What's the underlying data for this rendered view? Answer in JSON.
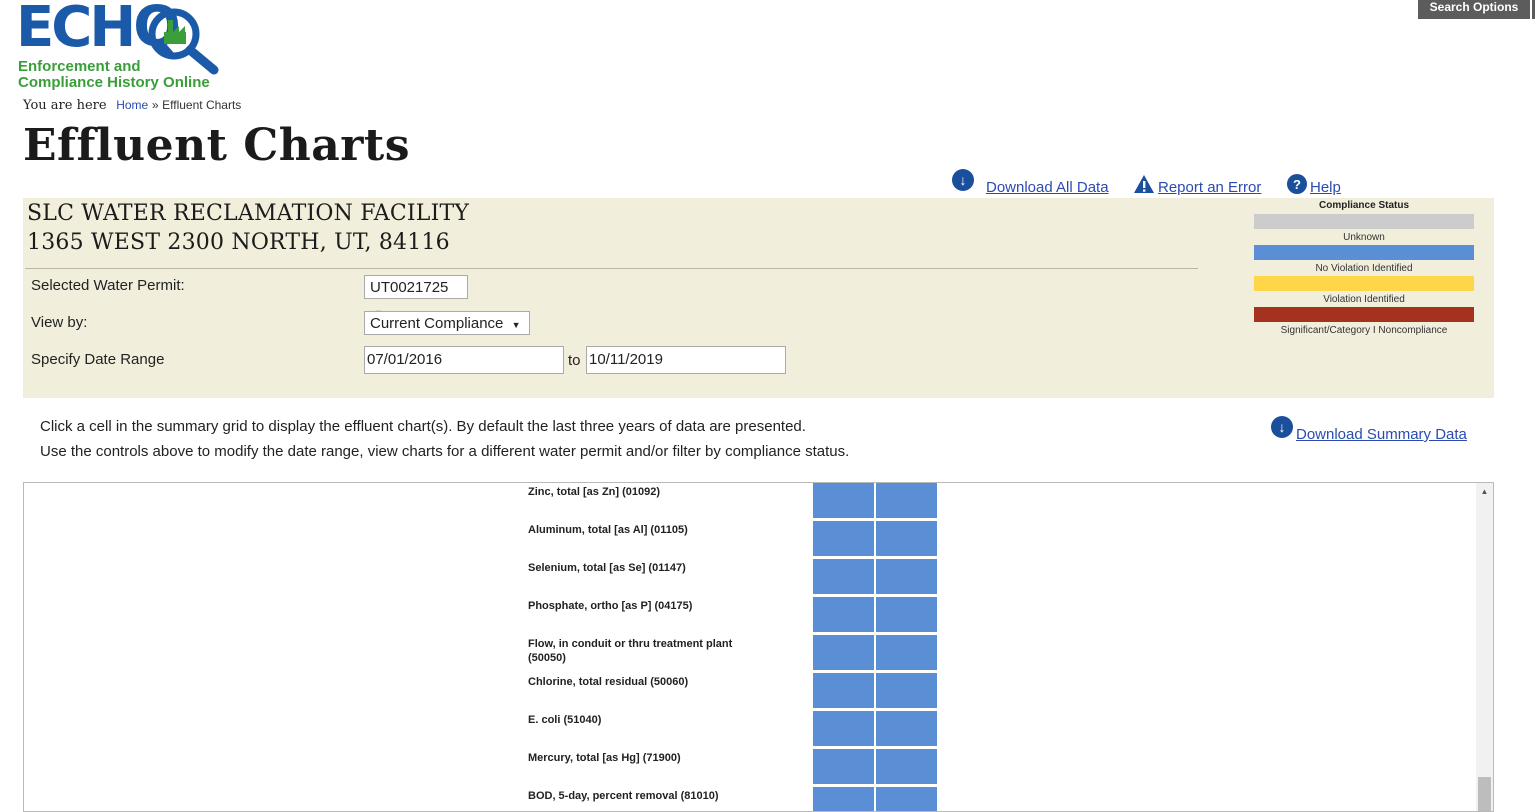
{
  "logo": {
    "word": "ECHQ",
    "sub_line1": "Enforcement and",
    "sub_line2": "Compliance History Online"
  },
  "header": {
    "search_options": "Search Options"
  },
  "breadcrumb": {
    "lead": "You are here",
    "home": "Home",
    "sep": "»",
    "current": "Effluent Charts"
  },
  "page": {
    "title": "Effluent Charts"
  },
  "actions": {
    "download_all": "Download All Data",
    "report_error": "Report an Error",
    "help": "Help"
  },
  "facility": {
    "name": "SLC WATER RECLAMATION FACILITY",
    "address": "1365 WEST 2300 NORTH, UT, 84116"
  },
  "form": {
    "permit_label": "Selected Water Permit:",
    "permit_value": "UT0021725",
    "viewby_label": "View by:",
    "viewby_value": "Current Compliance",
    "date_label": "Specify Date Range",
    "date_from": "07/01/2016",
    "date_to_label": "to",
    "date_to": "10/11/2019"
  },
  "legend": {
    "title": "Compliance Status",
    "items": [
      {
        "label": "Unknown",
        "color": "#cccccc"
      },
      {
        "label": "No Violation Identified",
        "color": "#5a8fd6"
      },
      {
        "label": "Violation Identified",
        "color": "#ffd54a"
      },
      {
        "label": "Significant/Category I Noncompliance",
        "color": "#a5321f"
      }
    ]
  },
  "instructions": {
    "line1": "Click a cell in the summary grid to display the effluent chart(s). By default the last three years of data are presented.",
    "line2": "Use the controls above to modify the date range, view charts for a different water permit and/or filter by compliance status.",
    "download_summary": "Download Summary Data"
  },
  "grid": {
    "cell_color": "#5a8fd6",
    "parameters": [
      {
        "name": "Zinc, total [as Zn] (01092)"
      },
      {
        "name": "Aluminum, total [as Al] (01105)"
      },
      {
        "name": "Selenium, total [as Se] (01147)"
      },
      {
        "name": "Phosphate, ortho [as P] (04175)"
      },
      {
        "name": "Flow, in conduit or thru treatment plant (50050)"
      },
      {
        "name": "Chlorine, total residual (50060)"
      },
      {
        "name": "E. coli (51040)"
      },
      {
        "name": "Mercury, total [as Hg] (71900)"
      },
      {
        "name": "BOD, 5-day, percent removal (81010)"
      }
    ]
  }
}
